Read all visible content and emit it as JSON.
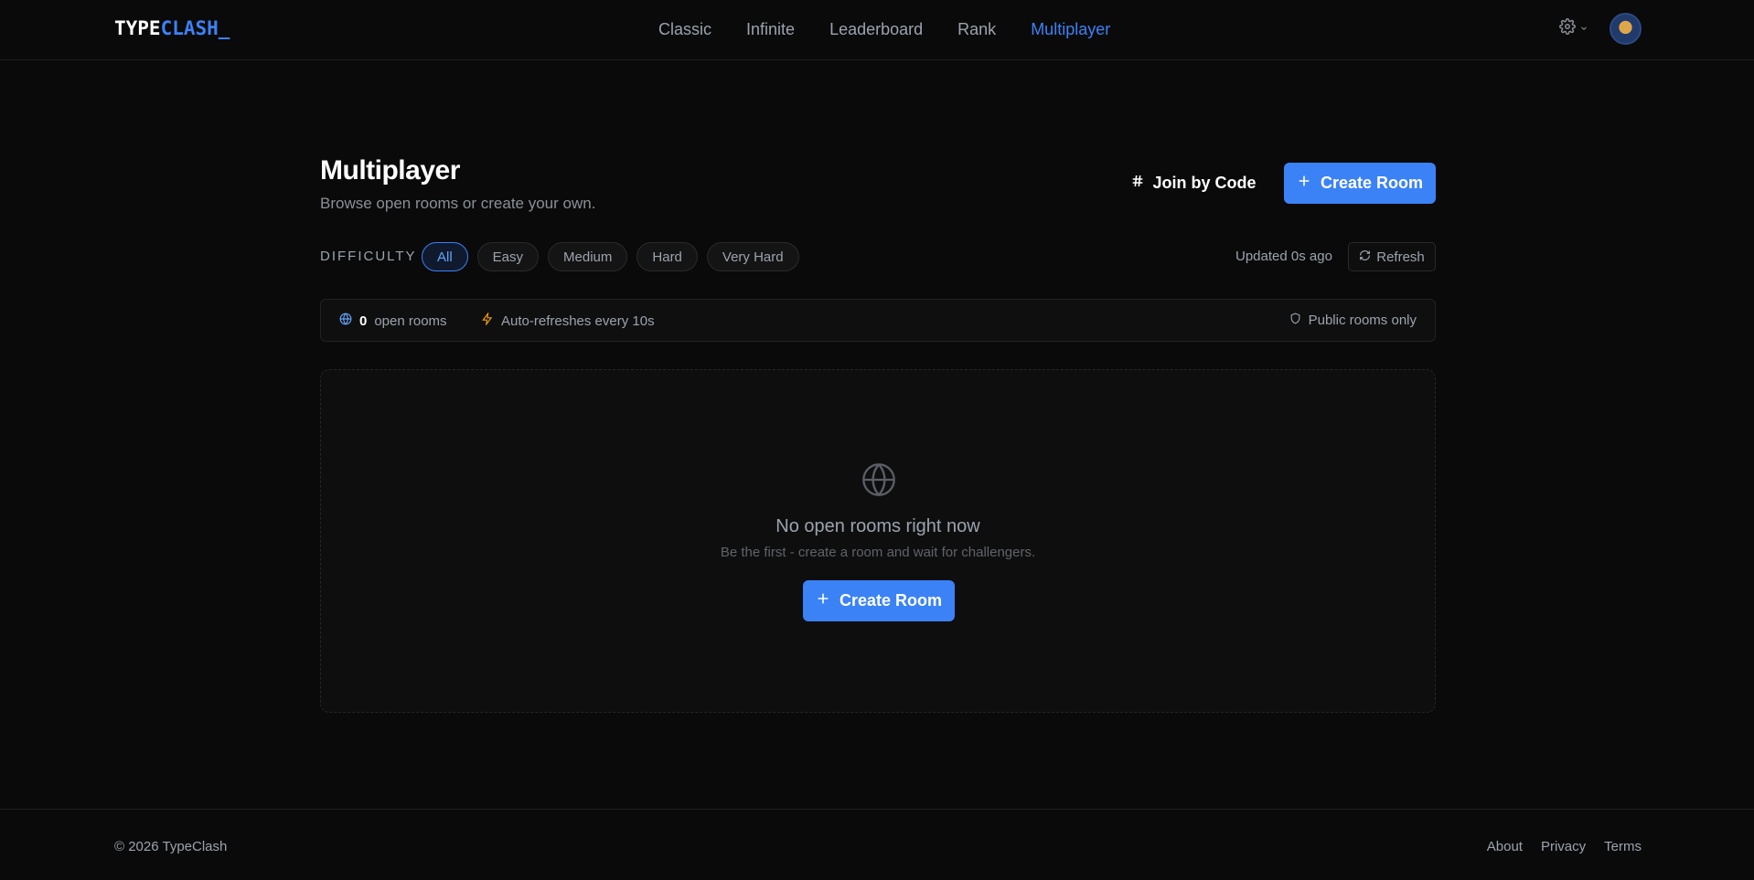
{
  "header": {
    "logo_part1": "TYPE",
    "logo_part2": "CLASH_",
    "nav": [
      "Classic",
      "Infinite",
      "Leaderboard",
      "Rank",
      "Multiplayer"
    ],
    "active_nav": "Multiplayer",
    "settings_icon": "gear-icon",
    "avatar_icon": "avatar"
  },
  "page": {
    "title": "Multiplayer",
    "subtitle": "Browse open rooms or create your own.",
    "join_label": "Join by Code",
    "create_label": "Create Room"
  },
  "filters": {
    "label": "DIFFICULTY",
    "chips": [
      "All",
      "Easy",
      "Medium",
      "Hard",
      "Very Hard"
    ],
    "active": "All",
    "updated": "Updated 0s ago",
    "refresh_label": "Refresh"
  },
  "info": {
    "count": "0",
    "count_label": "open rooms",
    "auto_refresh": "Auto-refreshes every 10s",
    "public_only": "Public rooms only"
  },
  "empty": {
    "title": "No open rooms right now",
    "subtitle": "Be the first - create a room and wait for challengers.",
    "button": "Create Room"
  },
  "footer": {
    "copyright": "© 2026 TypeClash",
    "links": [
      "About",
      "Privacy",
      "Terms"
    ]
  },
  "colors": {
    "accent": "#3b82f6",
    "background": "#0a0a0a",
    "bolt": "#f59e0b"
  }
}
